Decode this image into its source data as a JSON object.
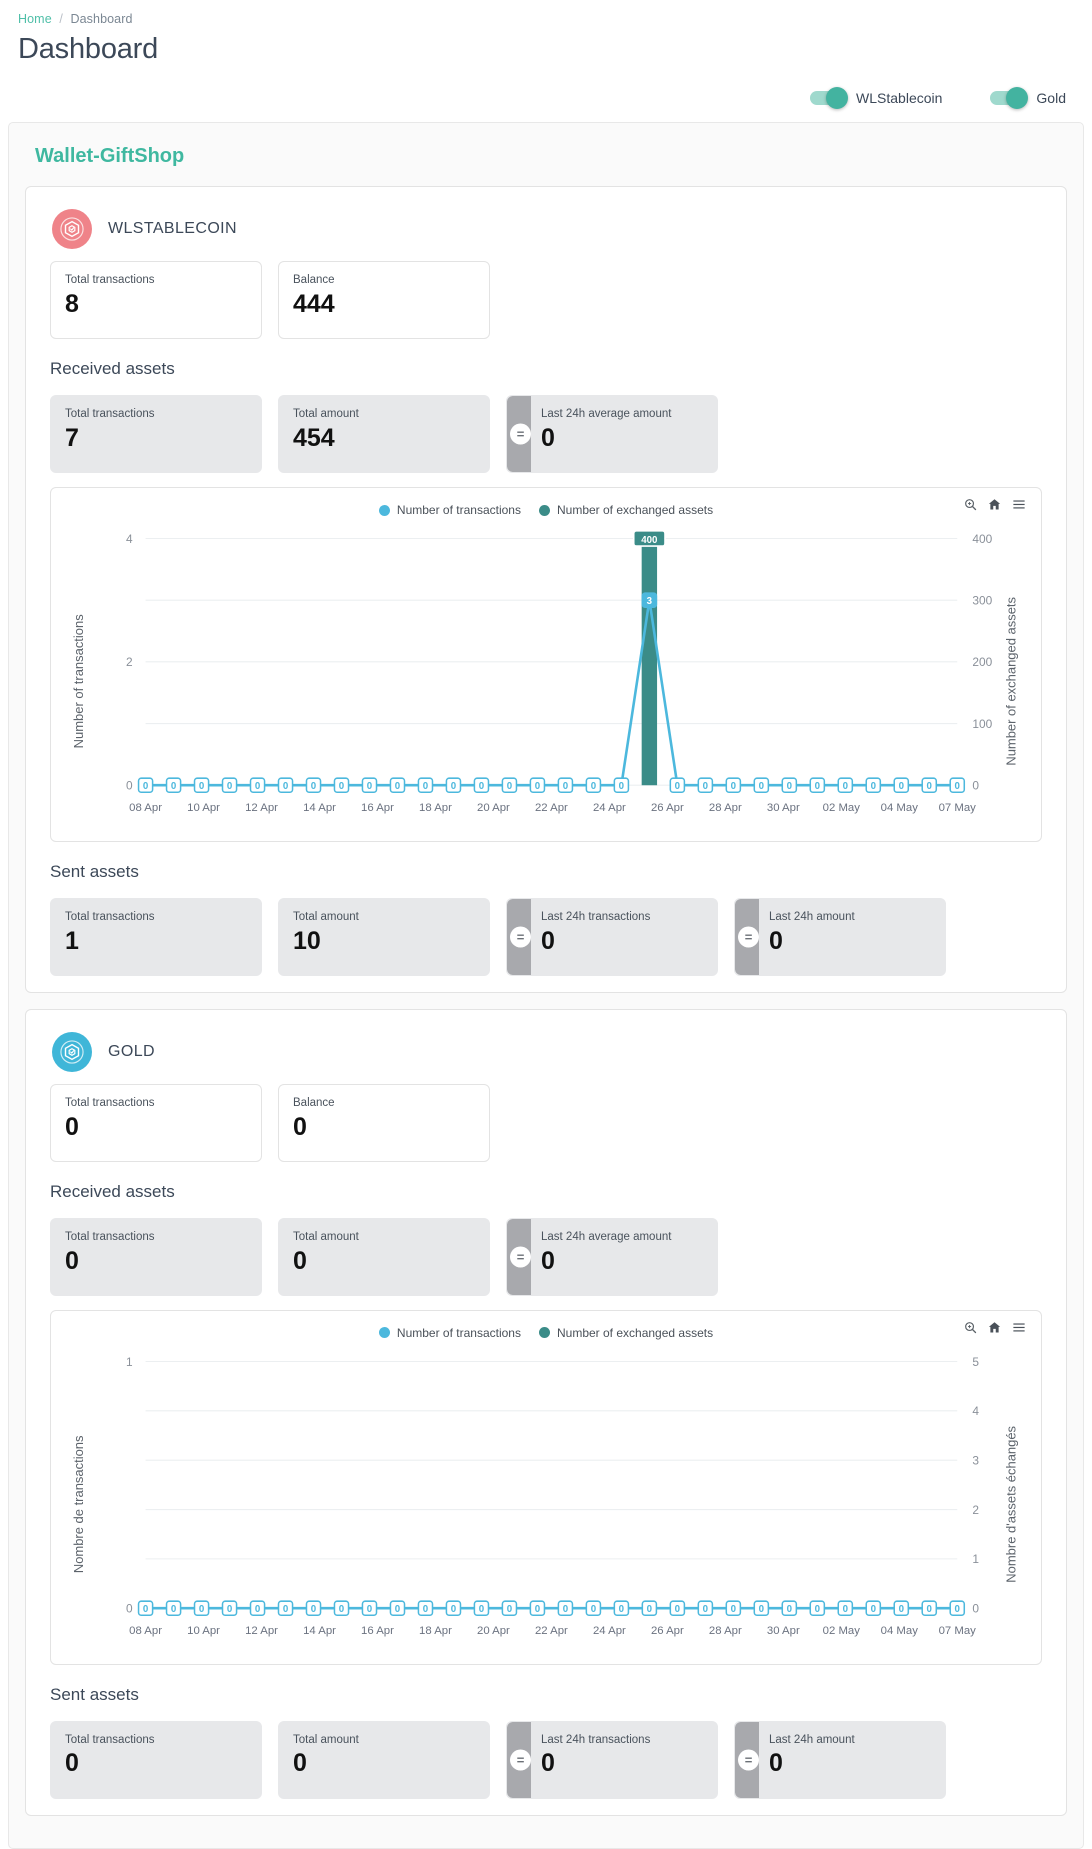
{
  "breadcrumb": {
    "home": "Home",
    "separator": "/",
    "current": "Dashboard"
  },
  "header": {
    "title": "Dashboard"
  },
  "toggles": [
    {
      "label": "WLStablecoin",
      "on": true
    },
    {
      "label": "Gold",
      "on": true
    }
  ],
  "panel": {
    "title": "Wallet-GiftShop"
  },
  "colors": {
    "accent": "#3fb8a0",
    "toggle_on": "#43b3a0",
    "wlstablecoin_icon_bg": "#ef8389",
    "gold_icon_bg": "#3fb6d8",
    "series_transactions": "#4cb8dd",
    "series_assets": "#3b8c88",
    "stat_gray_bg": "#e7e8ea",
    "stat_accent_bar": "#a8a9ad"
  },
  "assets": [
    {
      "name": "WLSTABLECOIN",
      "icon": "hexagon-cube-icon",
      "summary": [
        {
          "label": "Total transactions",
          "value": "8"
        },
        {
          "label": "Balance",
          "value": "444"
        }
      ],
      "received": {
        "section_label": "Received assets",
        "cards": [
          {
            "label": "Total transactions",
            "value": "7",
            "accent": false
          },
          {
            "label": "Total amount",
            "value": "454",
            "accent": false
          },
          {
            "label": "Last 24h average amount",
            "value": "0",
            "accent": true,
            "badge": "="
          }
        ]
      },
      "sent": {
        "section_label": "Sent assets",
        "cards": [
          {
            "label": "Total transactions",
            "value": "1",
            "accent": false
          },
          {
            "label": "Total amount",
            "value": "10",
            "accent": false
          },
          {
            "label": "Last 24h transactions",
            "value": "0",
            "accent": true,
            "badge": "="
          },
          {
            "label": "Last 24h amount",
            "value": "0",
            "accent": true,
            "badge": "="
          }
        ]
      },
      "chart_id": "chart-wlstablecoin"
    },
    {
      "name": "GOLD",
      "icon": "hexagon-cube-icon",
      "summary": [
        {
          "label": "Total transactions",
          "value": "0"
        },
        {
          "label": "Balance",
          "value": "0"
        }
      ],
      "received": {
        "section_label": "Received assets",
        "cards": [
          {
            "label": "Total transactions",
            "value": "0",
            "accent": false
          },
          {
            "label": "Total amount",
            "value": "0",
            "accent": false
          },
          {
            "label": "Last 24h average amount",
            "value": "0",
            "accent": true,
            "badge": "="
          }
        ]
      },
      "sent": {
        "section_label": "Sent assets",
        "cards": [
          {
            "label": "Total transactions",
            "value": "0",
            "accent": false
          },
          {
            "label": "Total amount",
            "value": "0",
            "accent": false
          },
          {
            "label": "Last 24h transactions",
            "value": "0",
            "accent": true,
            "badge": "="
          },
          {
            "label": "Last 24h amount",
            "value": "0",
            "accent": true,
            "badge": "="
          }
        ]
      },
      "chart_id": "chart-gold"
    }
  ],
  "chart_toolbar": {
    "zoom_icon": "magnifier-icon",
    "home_icon": "home-icon",
    "menu_icon": "hamburger-menu-icon"
  },
  "chart_data": [
    {
      "id": "chart-wlstablecoin",
      "type": "line",
      "title": "",
      "xlabel": "",
      "ylabel": "Number of transactions",
      "y2label": "Number of exchanged assets",
      "ylim": [
        0,
        4
      ],
      "y2lim": [
        0,
        400
      ],
      "yticks": [
        0,
        2,
        4
      ],
      "y2ticks": [
        0,
        100,
        200,
        300,
        400
      ],
      "grid": true,
      "legend_position": "top-center",
      "legend": [
        "Number of transactions",
        "Number of exchanged assets"
      ],
      "categories": [
        "08 Apr",
        "09 Apr",
        "10 Apr",
        "11 Apr",
        "12 Apr",
        "13 Apr",
        "14 Apr",
        "15 Apr",
        "16 Apr",
        "17 Apr",
        "18 Apr",
        "19 Apr",
        "20 Apr",
        "21 Apr",
        "22 Apr",
        "23 Apr",
        "24 Apr",
        "25 Apr",
        "26 Apr",
        "27 Apr",
        "28 Apr",
        "29 Apr",
        "30 Apr",
        "01 May",
        "02 May",
        "03 May",
        "04 May",
        "05 May",
        "06 May",
        "07 May"
      ],
      "xtick_labels": [
        "08 Apr",
        "10 Apr",
        "12 Apr",
        "14 Apr",
        "16 Apr",
        "18 Apr",
        "20 Apr",
        "22 Apr",
        "24 Apr",
        "26 Apr",
        "28 Apr",
        "30 Apr",
        "02 May",
        "04 May",
        "07 May"
      ],
      "series": [
        {
          "name": "Number of transactions",
          "axis": "left",
          "color": "#4cb8dd",
          "values": [
            0,
            0,
            0,
            0,
            0,
            0,
            0,
            0,
            0,
            0,
            0,
            0,
            0,
            0,
            0,
            0,
            0,
            0,
            3,
            0,
            0,
            0,
            0,
            0,
            0,
            0,
            0,
            0,
            0,
            0
          ]
        },
        {
          "name": "Number of exchanged assets",
          "axis": "right",
          "color": "#3b8c88",
          "values": [
            0,
            0,
            0,
            0,
            0,
            0,
            0,
            0,
            0,
            0,
            0,
            0,
            0,
            0,
            0,
            0,
            0,
            0,
            400,
            0,
            0,
            0,
            0,
            0,
            0,
            0,
            0,
            0,
            0,
            0
          ]
        }
      ],
      "point_labels": {
        "peak_transactions": "3",
        "peak_assets": "400",
        "zero": "0"
      }
    },
    {
      "id": "chart-gold",
      "type": "line",
      "title": "",
      "xlabel": "",
      "ylabel": "Nombre de transactions",
      "y2label": "Nombre d'assets échangés",
      "ylim": [
        0,
        1
      ],
      "y2lim": [
        0,
        5
      ],
      "yticks": [
        0,
        1
      ],
      "y2ticks": [
        0,
        1,
        2,
        3,
        4,
        5
      ],
      "grid": true,
      "legend_position": "top-center",
      "legend": [
        "Number of transactions",
        "Number of exchanged assets"
      ],
      "categories": [
        "08 Apr",
        "09 Apr",
        "10 Apr",
        "11 Apr",
        "12 Apr",
        "13 Apr",
        "14 Apr",
        "15 Apr",
        "16 Apr",
        "17 Apr",
        "18 Apr",
        "19 Apr",
        "20 Apr",
        "21 Apr",
        "22 Apr",
        "23 Apr",
        "24 Apr",
        "25 Apr",
        "26 Apr",
        "27 Apr",
        "28 Apr",
        "29 Apr",
        "30 Apr",
        "01 May",
        "02 May",
        "03 May",
        "04 May",
        "05 May",
        "06 May",
        "07 May"
      ],
      "xtick_labels": [
        "08 Apr",
        "10 Apr",
        "12 Apr",
        "14 Apr",
        "16 Apr",
        "18 Apr",
        "20 Apr",
        "22 Apr",
        "24 Apr",
        "26 Apr",
        "28 Apr",
        "30 Apr",
        "02 May",
        "04 May",
        "07 May"
      ],
      "series": [
        {
          "name": "Number of transactions",
          "axis": "left",
          "color": "#4cb8dd",
          "values": [
            0,
            0,
            0,
            0,
            0,
            0,
            0,
            0,
            0,
            0,
            0,
            0,
            0,
            0,
            0,
            0,
            0,
            0,
            0,
            0,
            0,
            0,
            0,
            0,
            0,
            0,
            0,
            0,
            0,
            0
          ]
        },
        {
          "name": "Number of exchanged assets",
          "axis": "right",
          "color": "#3b8c88",
          "values": [
            0,
            0,
            0,
            0,
            0,
            0,
            0,
            0,
            0,
            0,
            0,
            0,
            0,
            0,
            0,
            0,
            0,
            0,
            0,
            0,
            0,
            0,
            0,
            0,
            0,
            0,
            0,
            0,
            0,
            0
          ]
        }
      ],
      "point_labels": {
        "zero": "0"
      }
    }
  ]
}
